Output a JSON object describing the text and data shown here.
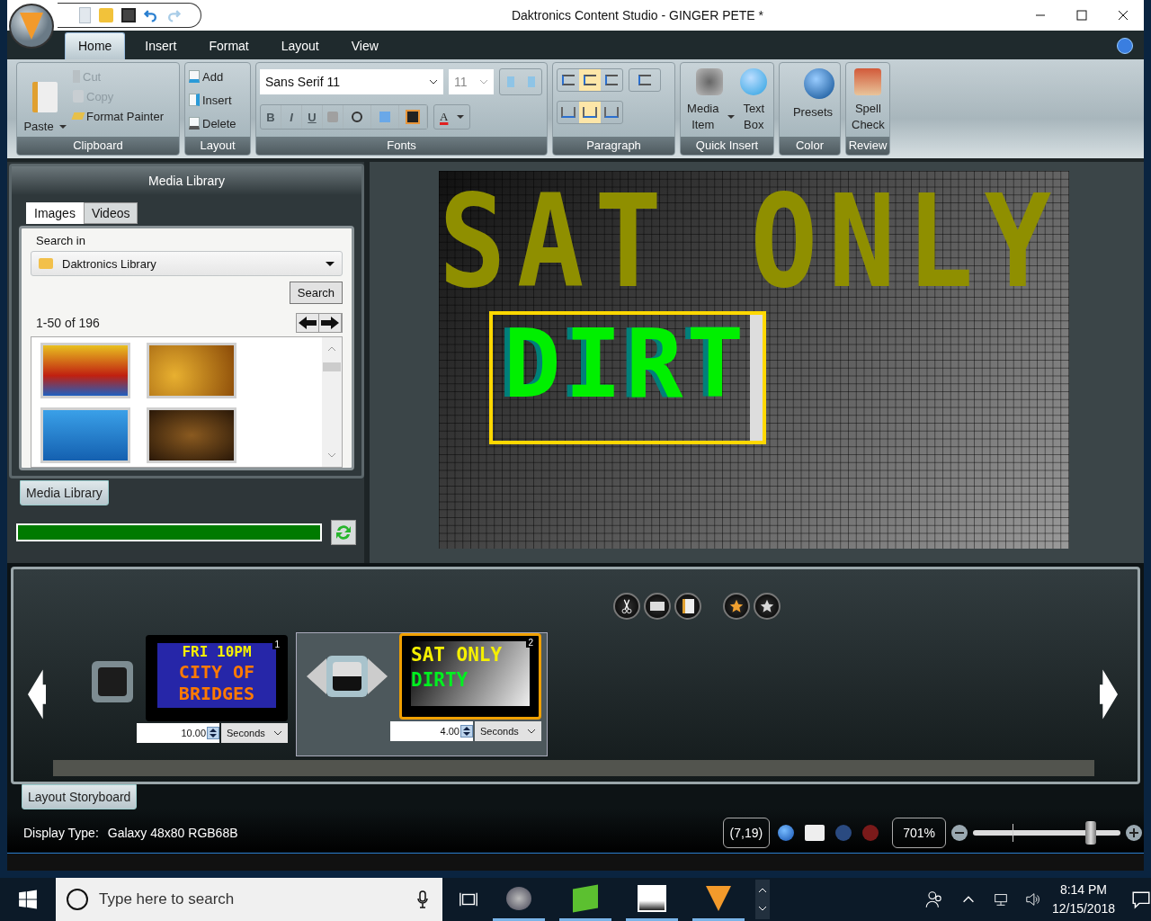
{
  "window": {
    "title": "Daktronics Content Studio - GINGER PETE *"
  },
  "ribbon_tabs": [
    {
      "label": "Home",
      "selected": true
    },
    {
      "label": "Insert",
      "selected": false
    },
    {
      "label": "Format",
      "selected": false
    },
    {
      "label": "Layout",
      "selected": false
    },
    {
      "label": "View",
      "selected": false
    }
  ],
  "clipboard": {
    "title": "Clipboard",
    "paste": "Paste",
    "items": [
      {
        "kind": "cut",
        "label": "Cut",
        "disabled": true
      },
      {
        "kind": "copy",
        "label": "Copy",
        "disabled": true
      },
      {
        "kind": "painter",
        "label": "Format Painter",
        "disabled": false
      }
    ]
  },
  "layout_group": {
    "title": "Layout",
    "items": [
      {
        "kind": "add",
        "label": "Add"
      },
      {
        "kind": "insert",
        "label": "Insert"
      },
      {
        "kind": "delete",
        "label": "Delete"
      }
    ]
  },
  "fonts": {
    "title": "Fonts",
    "font": "Sans Serif 11",
    "size": "11",
    "format_buttons": [
      {
        "label": "B"
      },
      {
        "label": "I"
      },
      {
        "label": "U"
      }
    ],
    "font_color": "A"
  },
  "paragraph": {
    "title": "Paragraph",
    "align": [
      {
        "selected": false
      },
      {
        "selected": true
      },
      {
        "selected": false
      }
    ],
    "valign": [
      {
        "selected": false
      },
      {
        "selected": true
      },
      {
        "selected": false
      }
    ]
  },
  "quick_insert": {
    "title": "Quick Insert",
    "items": [
      {
        "kind": "media",
        "label": "Media Item",
        "dropdown": true
      },
      {
        "kind": "text",
        "label": "Text Box",
        "dropdown": false
      }
    ]
  },
  "color": {
    "title": "Color",
    "presets": "Presets"
  },
  "review": {
    "title": "Review",
    "spell": "Spell Check"
  },
  "media_library": {
    "title": "Media Library",
    "tabs": [
      {
        "label": "Images",
        "selected": true
      },
      {
        "label": "Videos",
        "selected": false
      }
    ],
    "search_in": "Search in",
    "location": "Daktronics Library",
    "search_button": "Search",
    "count": "1-50 of 196",
    "thumbnails": [
      {
        "kind": "energy"
      },
      {
        "kind": "beer"
      },
      {
        "kind": "water"
      },
      {
        "kind": "coffee"
      }
    ],
    "panel_tab": "Media Library",
    "progress": {
      "level": 1
    }
  },
  "canvas": {
    "background_text": "SAT ONLY",
    "selected_text": "DIRT"
  },
  "storyboard": {
    "slides": [
      {
        "number": "1",
        "kind": "blue",
        "selected": false,
        "lines": [
          {
            "text": "FRI 10PM",
            "color": "#f5f000"
          },
          {
            "text": "CITY OF",
            "color": "#ff7a00"
          },
          {
            "text": "BRIDGES",
            "color": "#ff7a00"
          }
        ],
        "duration": "10.00",
        "unit": "Seconds"
      },
      {
        "number": "2",
        "kind": "gradient",
        "selected": true,
        "lines": [
          {
            "text": "SAT ONLY",
            "color": "#f5f000"
          },
          {
            "text": "DIRTY",
            "color": "#00f020"
          }
        ],
        "duration": "4.00",
        "unit": "Seconds"
      }
    ],
    "tab": "Layout Storyboard"
  },
  "status": {
    "display_type_label": "Display Type:",
    "display_type": "Galaxy 48x80 RGB68B",
    "coords": "(7,19)",
    "zoom": "701%",
    "zoom_slider": {
      "level": 0.8
    }
  },
  "taskbar": {
    "search_placeholder": "Type here to search",
    "time": "8:14 PM",
    "date": "12/15/2018"
  }
}
